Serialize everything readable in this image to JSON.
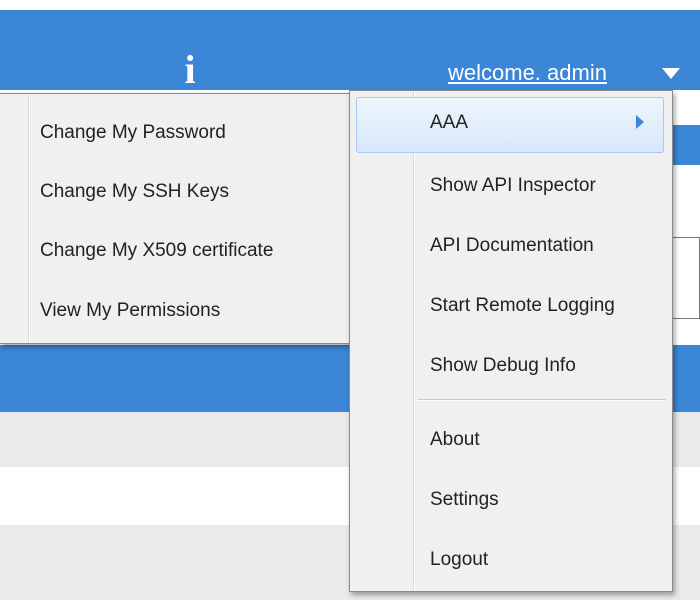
{
  "header": {
    "info_icon_glyph": "i",
    "welcome_text": "welcome. admin",
    "accent_color": "#3b86d6"
  },
  "user_menu": {
    "items": [
      {
        "label": "AAA",
        "has_submenu": true,
        "highlighted": true
      },
      {
        "label": "Show API Inspector"
      },
      {
        "label": "API Documentation"
      },
      {
        "label": "Start Remote Logging"
      },
      {
        "label": "Show Debug Info"
      },
      {
        "label": "About"
      },
      {
        "label": "Settings"
      },
      {
        "label": "Logout"
      }
    ]
  },
  "aaa_submenu": {
    "items": [
      {
        "label": "Change My Password"
      },
      {
        "label": "Change My SSH Keys"
      },
      {
        "label": "Change My X509 certificate"
      },
      {
        "label": "View My Permissions"
      }
    ]
  }
}
